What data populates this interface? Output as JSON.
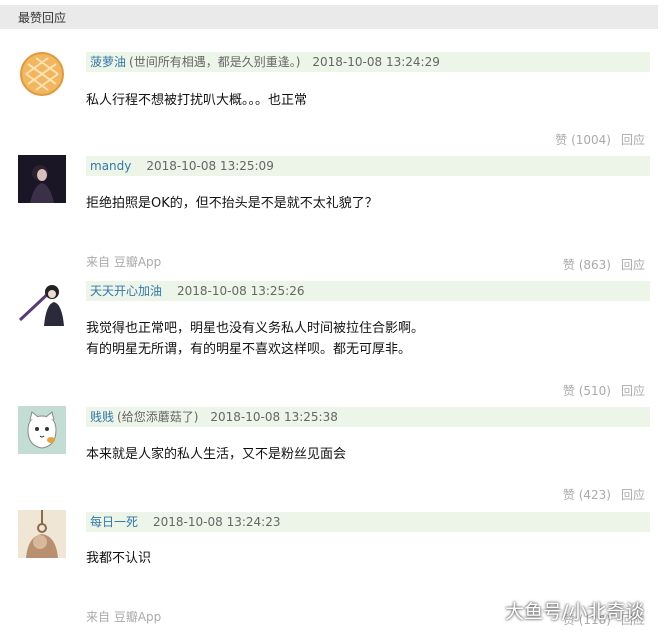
{
  "section": {
    "title": "最赞回应"
  },
  "comments": [
    {
      "username": "菠萝油",
      "signature": "(世间所有相遇，都是久别重逢。)",
      "timestamp": "2018-10-08 13:24:29",
      "lines": [
        "私人行程不想被打扰叭大概。。。也正常"
      ],
      "source": "",
      "likes": "赞 (1004)",
      "reply": "回应"
    },
    {
      "username": "mandy",
      "signature": "",
      "timestamp": "2018-10-08 13:25:09",
      "lines": [
        "拒绝拍照是OK的，但不抬头是不是就不太礼貌了？"
      ],
      "source": "来自 豆瓣App",
      "likes": "赞 (863)",
      "reply": "回应"
    },
    {
      "username": "天天开心加油",
      "signature": "",
      "timestamp": "2018-10-08 13:25:26",
      "lines": [
        "我觉得也正常吧，明星也没有义务私人时间被拉住合影啊。",
        "有的明星无所谓，有的明星不喜欢这样呗。都无可厚非。"
      ],
      "source": "",
      "likes": "赞 (510)",
      "reply": "回应"
    },
    {
      "username": "贱贱",
      "signature": "(给您添蘑菇了)",
      "timestamp": "2018-10-08 13:25:38",
      "lines": [
        "本来就是人家的私人生活，又不是粉丝见面会"
      ],
      "source": "",
      "likes": "赞 (423)",
      "reply": "回应"
    },
    {
      "username": "每日一死",
      "signature": "",
      "timestamp": "2018-10-08 13:24:23",
      "lines": [
        "我都不认识"
      ],
      "source": "来自 豆瓣App",
      "likes": "赞 (118)",
      "reply": "回应"
    }
  ],
  "watermark": "大鱼号/小北奇谈"
}
